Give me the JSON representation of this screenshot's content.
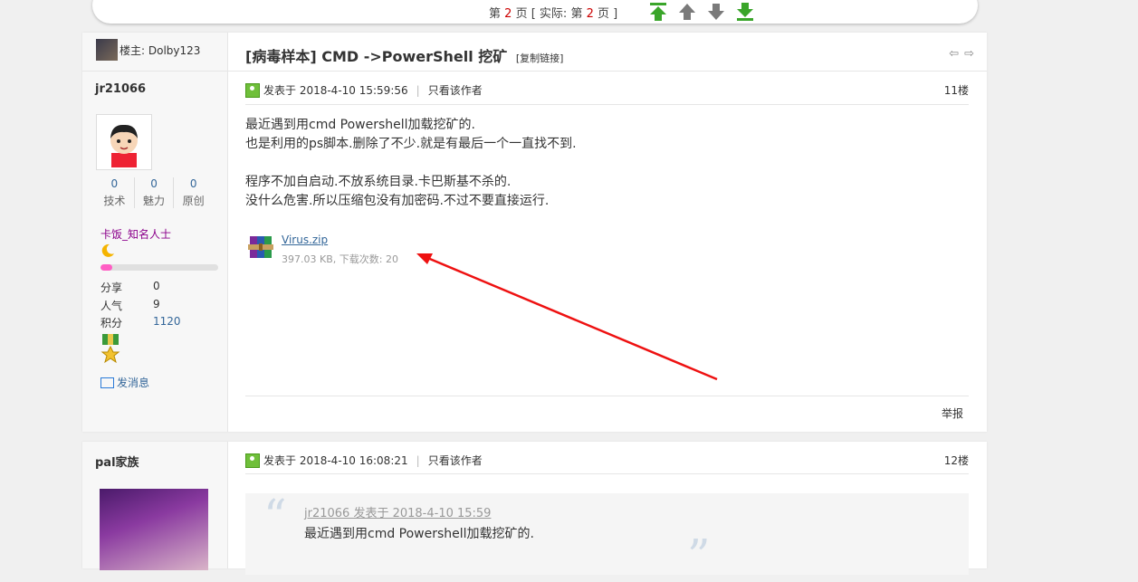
{
  "pager": {
    "prefix": "第",
    "page": "2",
    "mid": "页 [ 实际:",
    "real_prefix": "第",
    "real_page": "2",
    "suffix": "页 ]"
  },
  "thread": {
    "op_label": "楼主: Dolby123",
    "title": "[病毒样本] CMD ->PowerShell 挖矿",
    "copy_link": "[复制链接]"
  },
  "post1": {
    "username": "jr21066",
    "stats": [
      {
        "value": "0",
        "label": "技术"
      },
      {
        "value": "0",
        "label": "魅力"
      },
      {
        "value": "0",
        "label": "原创"
      }
    ],
    "group": "卡饭_知名人士",
    "progress": 0.1,
    "info": [
      {
        "k": "分享",
        "v": "0"
      },
      {
        "k": "人气",
        "v": "9"
      },
      {
        "k": "积分",
        "v": "1120"
      }
    ],
    "send_message": "发消息",
    "posted": "发表于 2018-4-10 15:59:56",
    "only_author": "只看该作者",
    "floor": "11楼",
    "lines": [
      "最近遇到用cmd Powershell加载挖矿的.",
      "也是利用的ps脚本.删除了不少.就是有最后一个一直找不到.",
      "",
      "程序不加自启动.不放系统目录.卡巴斯基不杀的.",
      "没什么危害.所以压缩包没有加密码.不过不要直接运行."
    ],
    "attachment": {
      "name": "Virus.zip",
      "size": "397.03 KB, 下载次数: 20"
    },
    "report": "举报"
  },
  "post2": {
    "username": "pal家族",
    "posted": "发表于 2018-4-10 16:08:21",
    "only_author": "只看该作者",
    "floor": "12楼",
    "quote_head": "jr21066 发表于 2018-4-10 15:59",
    "quote_text": "最近遇到用cmd Powershell加载挖矿的."
  },
  "colors": {
    "accent_link": "#336699",
    "annotation_arrow": "#ee1111",
    "group_color": "#8B008B"
  }
}
